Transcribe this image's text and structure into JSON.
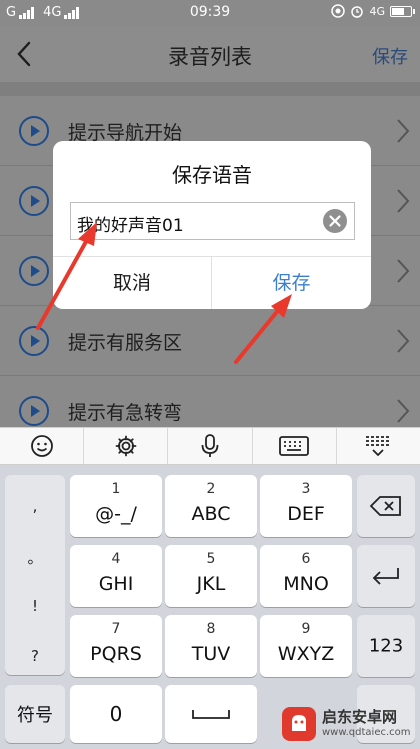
{
  "status_bar": {
    "carrier": "G",
    "network": "4G",
    "time": "09:39",
    "network_right": "4G"
  },
  "nav": {
    "title": "录音列表",
    "save_label": "保存"
  },
  "list": {
    "items": [
      {
        "label": "提示导航开始"
      },
      {
        "label": ""
      },
      {
        "label": ""
      },
      {
        "label": "提示有服务区"
      },
      {
        "label": "提示有急转弯"
      }
    ]
  },
  "dialog": {
    "title": "保存语音",
    "input_value": "我的好声音01",
    "cancel_label": "取消",
    "save_label": "保存"
  },
  "keyboard": {
    "punctuation": [
      ",",
      "。",
      "!",
      "?"
    ],
    "keys": [
      {
        "num": "1",
        "letters": "@-_/"
      },
      {
        "num": "2",
        "letters": "ABC"
      },
      {
        "num": "3",
        "letters": "DEF"
      },
      {
        "num": "4",
        "letters": "GHI"
      },
      {
        "num": "5",
        "letters": "JKL"
      },
      {
        "num": "6",
        "letters": "MNO"
      },
      {
        "num": "7",
        "letters": "PQRS"
      },
      {
        "num": "8",
        "letters": "TUV"
      },
      {
        "num": "9",
        "letters": "WXYZ"
      }
    ],
    "num_mode_label": "123",
    "symbol_label": "符号",
    "zero_label": "0"
  },
  "watermark": {
    "title": "启东安卓网",
    "url": "www.qdtaiec.com"
  },
  "colors": {
    "accent": "#3d7fcf",
    "annotation": "#e8392c",
    "overlay": "#8a8a8a"
  }
}
